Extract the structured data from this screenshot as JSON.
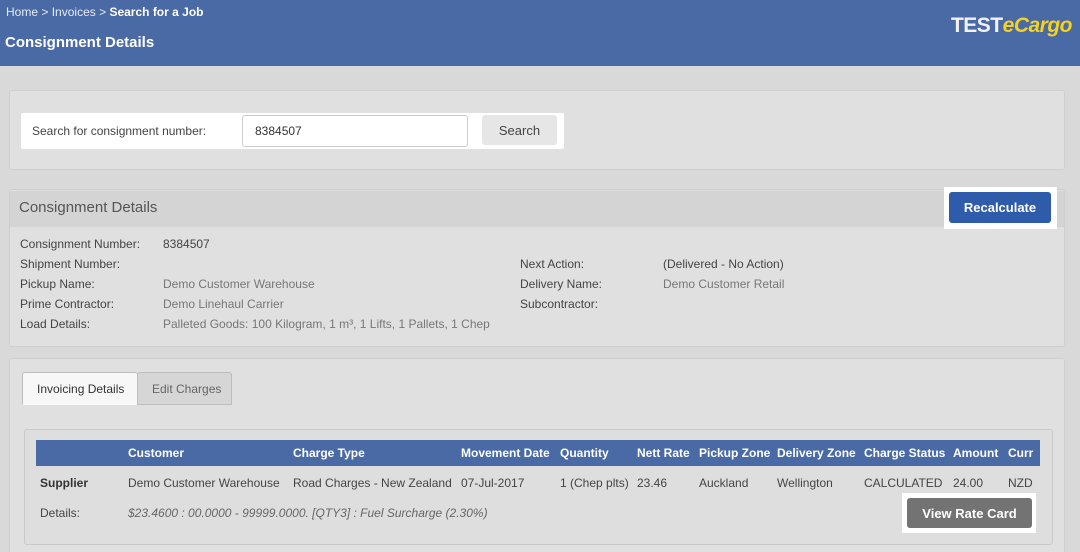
{
  "header": {
    "breadcrumb": [
      "Home",
      "Invoices",
      "Search for a Job"
    ],
    "separator": ">",
    "title": "Consignment Details",
    "logo_test": "TEST",
    "logo_ecargo": "eCargo",
    "color": "#4a6aa6"
  },
  "search": {
    "label": "Search for consignment number:",
    "value": "8384507",
    "button": "Search"
  },
  "details": {
    "title": "Consignment Details",
    "recalculate": "Recalculate",
    "left": [
      {
        "label": "Consignment Number:",
        "value": "8384507"
      },
      {
        "label": "Shipment Number:",
        "value": ""
      },
      {
        "label": "Pickup Name:",
        "value": "Demo Customer Warehouse"
      },
      {
        "label": "Prime Contractor:",
        "value": "Demo Linehaul Carrier"
      },
      {
        "label": "Load Details:",
        "value": "Palleted Goods: 100 Kilogram, 1 m³, 1 Lifts, 1 Pallets, 1 Chep"
      }
    ],
    "right": [
      {
        "label": "Next Action:",
        "value": "(Delivered - No Action)"
      },
      {
        "label": "Delivery Name:",
        "value": "Demo Customer Retail"
      },
      {
        "label": "Subcontractor:",
        "value": ""
      }
    ]
  },
  "tabs": [
    {
      "label": "Invoicing Details",
      "active": true
    },
    {
      "label": "Edit Charges",
      "active": false
    }
  ],
  "table": {
    "columns": [
      "",
      "Customer",
      "Charge Type",
      "Movement Date",
      "Quantity",
      "Nett Rate",
      "Pickup Zone",
      "Delivery Zone",
      "Charge Status",
      "Amount",
      "Curr"
    ],
    "row": [
      "Supplier",
      "Demo Customer Warehouse",
      "Road Charges - New Zealand",
      "07-Jul-2017",
      "1 (Chep plts)",
      "23.46",
      "Auckland",
      "Wellington",
      "CALCULATED",
      "24.00",
      "NZD"
    ],
    "details_label": "Details:",
    "details_text": "$23.4600 : 00.0000 - 99999.0000. [QTY3] : Fuel Surcharge (2.30%)",
    "rate_button": "View Rate Card"
  }
}
